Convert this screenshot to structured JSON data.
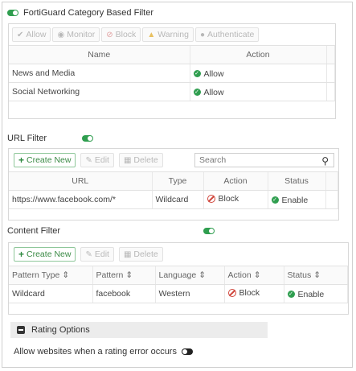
{
  "category_filter": {
    "title": "FortiGuard Category Based Filter",
    "toggle_on": true,
    "buttons": [
      {
        "icon": "circle-check-icon",
        "label": "Allow"
      },
      {
        "icon": "eye-icon",
        "label": "Monitor"
      },
      {
        "icon": "block-icon",
        "label": "Block"
      },
      {
        "icon": "warning-icon",
        "label": "Warning"
      },
      {
        "icon": "user-icon",
        "label": "Authenticate"
      }
    ],
    "columns": [
      "Name",
      "Action"
    ],
    "rows": [
      {
        "name": "News and Media",
        "action": "Allow"
      },
      {
        "name": "Social Networking",
        "action": "Allow"
      }
    ]
  },
  "url_filter": {
    "title": "URL Filter",
    "toggle_on": true,
    "create_label": "Create New",
    "edit_label": "Edit",
    "delete_label": "Delete",
    "search_placeholder": "Search",
    "columns": [
      "URL",
      "Type",
      "Action",
      "Status"
    ],
    "rows": [
      {
        "url": "https://www.facebook.com/*",
        "type": "Wildcard",
        "action": "Block",
        "status": "Enable"
      }
    ]
  },
  "content_filter": {
    "title": "Content Filter",
    "toggle_on": true,
    "create_label": "Create New",
    "edit_label": "Edit",
    "delete_label": "Delete",
    "columns": [
      "Pattern Type ⇕",
      "Pattern ⇕",
      "Language ⇕",
      "Action ⇕",
      "Status ⇕"
    ],
    "rows": [
      {
        "pattern_type": "Wildcard",
        "pattern": "facebook",
        "language": "Western",
        "action": "Block",
        "status": "Enable"
      }
    ]
  },
  "rating_options": {
    "title": "Rating Options",
    "allow_label": "Allow websites when a rating error occurs",
    "allow_toggle_on": false
  },
  "colors": {
    "green": "#2f9e4f",
    "red": "#d0463c",
    "header_bg": "#fafafa"
  }
}
